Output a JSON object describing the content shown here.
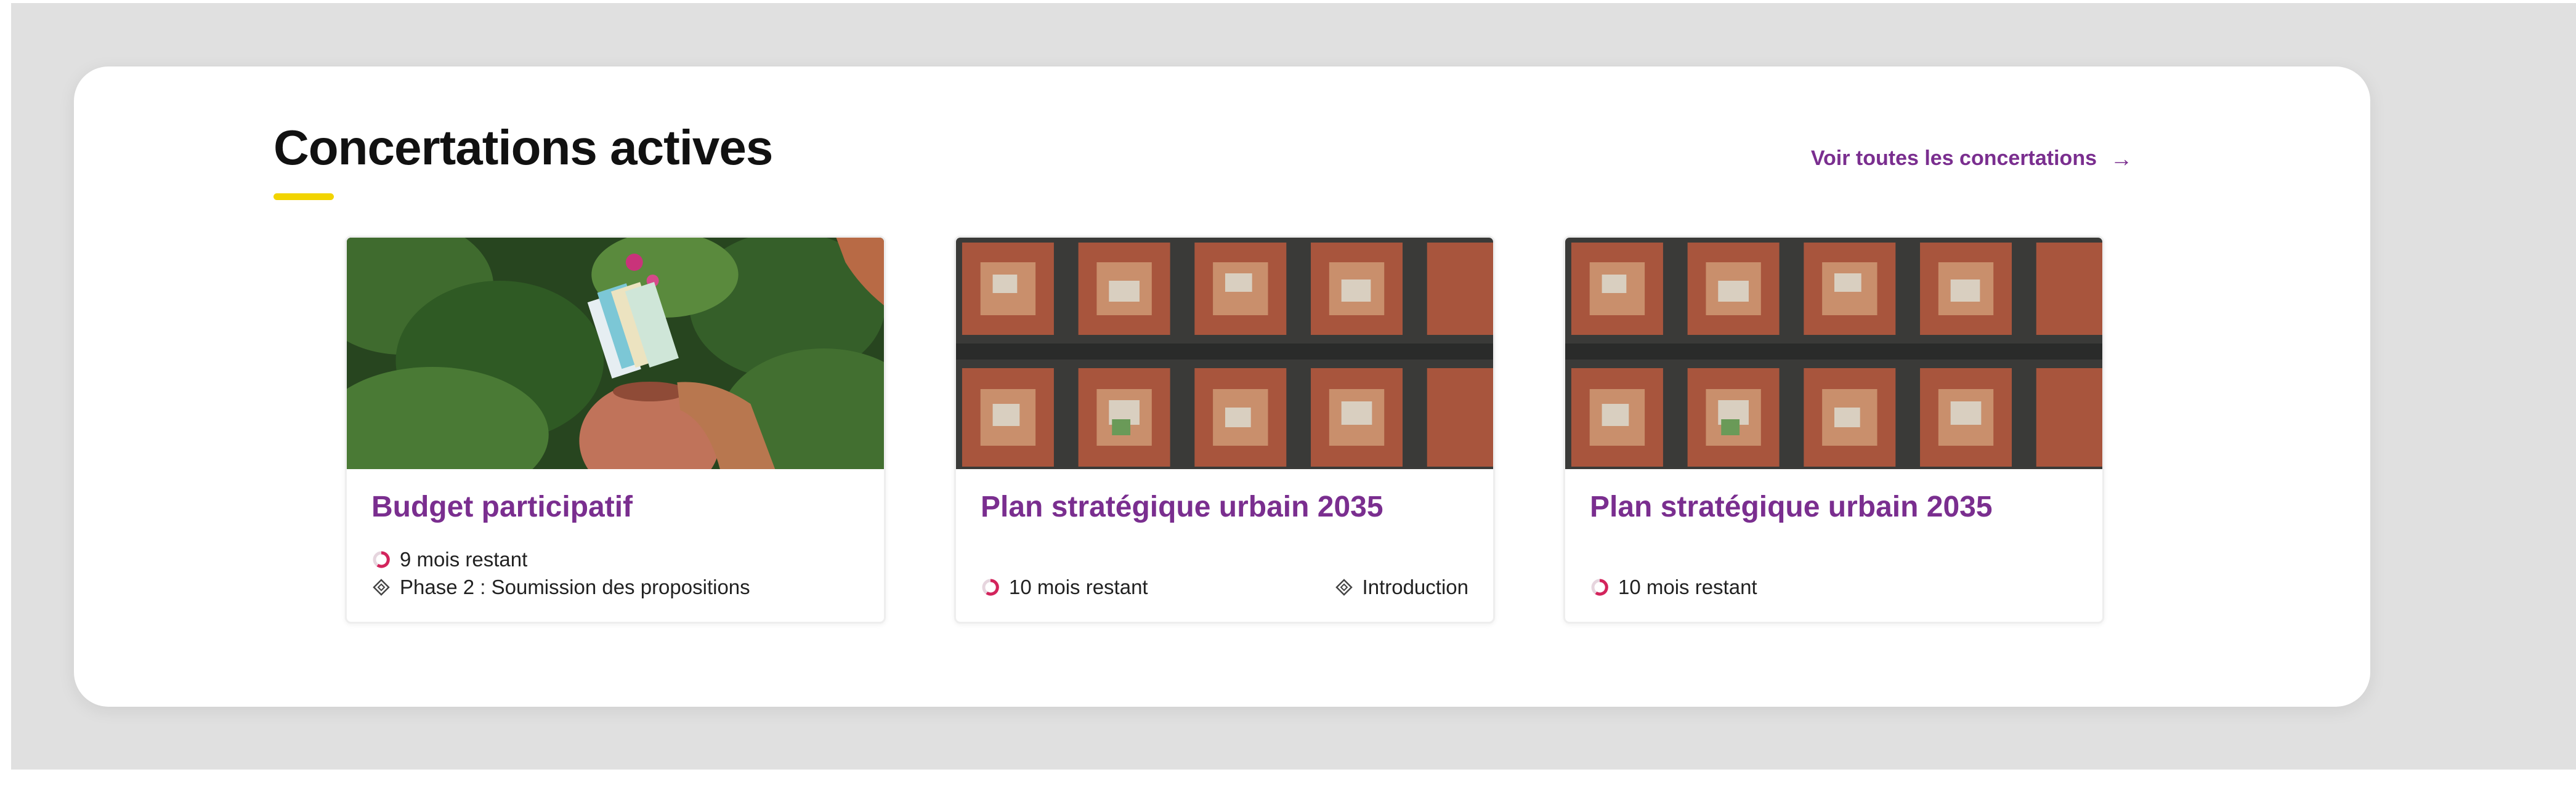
{
  "section": {
    "title": "Concertations actives",
    "see_all_label": "Voir toutes les concertations",
    "accent_color": "#f2d400",
    "link_color": "#7a2e8f"
  },
  "cards": [
    {
      "title": "Budget participatif",
      "image": "hand-holding-money-jar",
      "time_remaining": "9 mois restant",
      "phase": "Phase 2 : Soumission des propositions"
    },
    {
      "title": "Plan stratégique urbain 2035",
      "image": "aerial-city-blocks",
      "time_remaining": "10 mois restant",
      "phase": "Introduction"
    },
    {
      "title": "Plan stratégique urbain 2035",
      "image": "aerial-city-blocks",
      "time_remaining": "10 mois restant"
    }
  ]
}
